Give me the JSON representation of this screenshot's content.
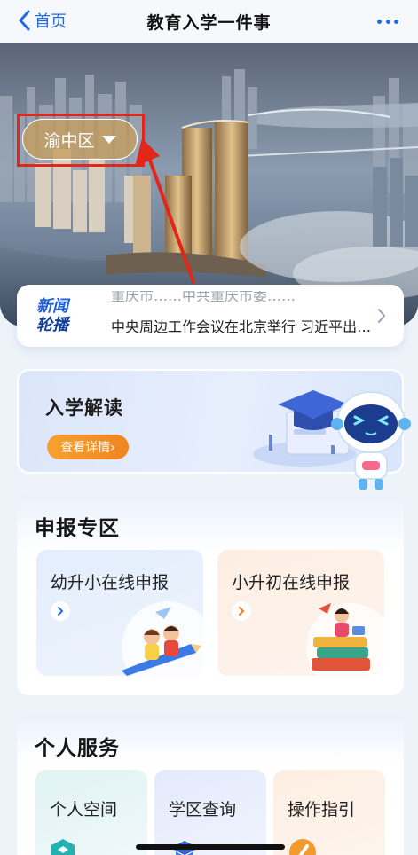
{
  "nav": {
    "back_label": "首页",
    "title": "教育入学一件事",
    "more_icon": "more-dots-icon"
  },
  "hero": {
    "district": "渝中区",
    "dropdown_icon": "triangle-down-icon"
  },
  "news": {
    "badge_line1": "新闻",
    "badge_line2": "轮播",
    "previous_headline": "重庆市……中共重庆市委……",
    "headline": "中央周边工作会议在北京举行 习近平出席会议并发表重要讲话"
  },
  "intro": {
    "title": "入学解读",
    "button_label": "查看详情›"
  },
  "declare": {
    "title": "申报专区",
    "tiles": [
      {
        "label": "幼升小在线申报"
      },
      {
        "label": "小升初在线申报"
      }
    ]
  },
  "personal": {
    "title": "个人服务",
    "services": [
      {
        "label": "个人空间",
        "icon": "cube-icon"
      },
      {
        "label": "学区查询",
        "icon": "graduation-cap-icon"
      },
      {
        "label": "操作指引",
        "icon": "guide-icon"
      }
    ]
  },
  "colors": {
    "accent_blue": "#1e6ce8",
    "highlight_red": "#e1261c",
    "button_orange": "#f08521"
  }
}
